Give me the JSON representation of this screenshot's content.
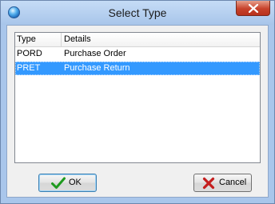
{
  "window": {
    "title": "Select Type",
    "app_icon": "globe-icon",
    "close_icon": "close-icon"
  },
  "grid": {
    "columns": [
      "Type",
      "Details"
    ],
    "rows": [
      {
        "type": "PORD",
        "details": "Purchase Order",
        "selected": false
      },
      {
        "type": "PRET",
        "details": "Purchase Return",
        "selected": true
      }
    ],
    "selection_color": "#3399ff"
  },
  "buttons": {
    "ok_label": "OK",
    "ok_icon": "checkmark-icon",
    "cancel_label": "Cancel",
    "cancel_icon": "x-icon"
  }
}
